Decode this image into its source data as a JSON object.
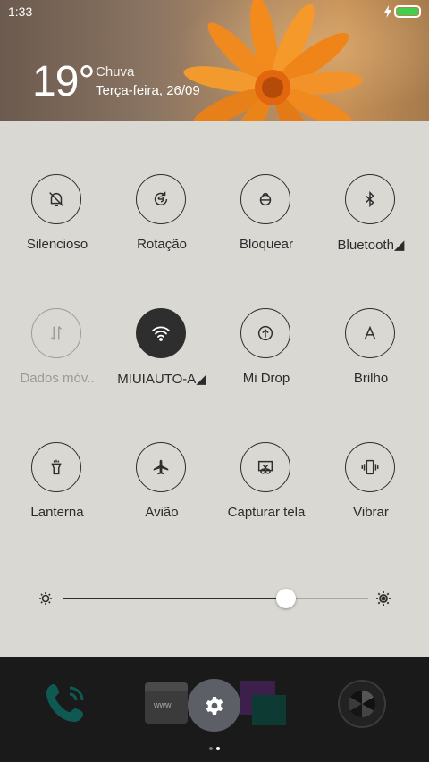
{
  "status_bar": {
    "time": "1:33",
    "battery_icon": "battery-full-icon",
    "charging_icon": "charging-bolt-icon"
  },
  "weather": {
    "temperature": "19°",
    "condition": "Chuva",
    "date": "Terça-feira, 26/09"
  },
  "toggles": [
    {
      "label": "Silencioso",
      "icon": "bell-off-icon",
      "state": "off"
    },
    {
      "label": "Rotação",
      "icon": "rotation-lock-icon",
      "state": "off"
    },
    {
      "label": "Bloquear",
      "icon": "lock-icon",
      "state": "off"
    },
    {
      "label": "Bluetooth◢",
      "icon": "bluetooth-icon",
      "state": "off"
    },
    {
      "label": "Dados móv..",
      "icon": "mobile-data-icon",
      "state": "disabled"
    },
    {
      "label": "MIUIAUTO-A◢",
      "icon": "wifi-icon",
      "state": "on"
    },
    {
      "label": "Mi Drop",
      "icon": "mi-drop-icon",
      "state": "off"
    },
    {
      "label": "Brilho",
      "icon": "auto-brightness-icon",
      "state": "off"
    },
    {
      "label": "Lanterna",
      "icon": "flashlight-icon",
      "state": "off"
    },
    {
      "label": "Avião",
      "icon": "airplane-icon",
      "state": "off"
    },
    {
      "label": "Capturar tela",
      "icon": "screenshot-icon",
      "state": "off"
    },
    {
      "label": "Vibrar",
      "icon": "vibrate-icon",
      "state": "off"
    }
  ],
  "brightness": {
    "level": 0.73
  },
  "dock": {
    "apps": [
      "phone-app-icon",
      "browser-app-icon",
      "gallery-app-icon",
      "camera-app-icon"
    ],
    "settings_button": "gear-icon",
    "page_indicator": {
      "pages": 2,
      "current": 2
    }
  },
  "colors": {
    "panel": "#d9d8d3",
    "dark": "#2e2e2e",
    "battery": "#41d04b",
    "flower": "#f08a1e"
  }
}
